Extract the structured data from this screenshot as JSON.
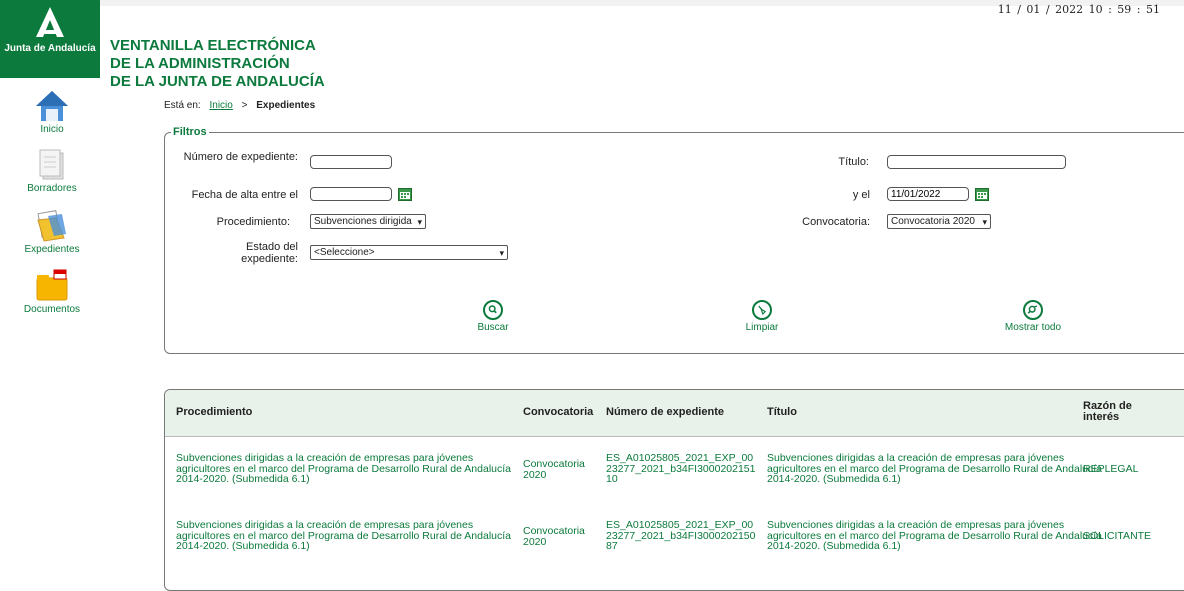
{
  "header": {
    "datetime": "11 / 01 / 2022   10 : 59 : 51",
    "logo_text": "Junta de Andalucía",
    "title_lines": [
      "VENTANILLA ELECTRÓNICA",
      "DE LA ADMINISTRACIÓN",
      "DE LA JUNTA DE ANDALUCÍA"
    ]
  },
  "breadcrumb": {
    "prefix": "Está en:",
    "home": "Inicio",
    "separator": ">",
    "current": "Expedientes"
  },
  "sidebar": {
    "items": [
      {
        "label": "Inicio",
        "icon": "home-icon"
      },
      {
        "label": "Borradores",
        "icon": "drafts-icon"
      },
      {
        "label": "Expedientes",
        "icon": "folder-icon"
      },
      {
        "label": "Documentos",
        "icon": "pdf-folder-icon"
      }
    ]
  },
  "filters": {
    "legend": "Filtros",
    "numero_label": "Número de expediente:",
    "numero_value": "",
    "titulo_label": "Título:",
    "titulo_value": "",
    "fecha_label": "Fecha de alta entre el",
    "fecha_desde": "",
    "ye_label": "y el",
    "fecha_hasta": "11/01/2022",
    "procedimiento_label": "Procedimiento:",
    "procedimiento_value": "Subvenciones dirigida",
    "convocatoria_label": "Convocatoria:",
    "convocatoria_value": "Convocatoria 2020",
    "estado_label": "Estado del expediente:",
    "estado_value": "<Seleccione>",
    "buttons": {
      "buscar": "Buscar",
      "limpiar": "Limpiar",
      "mostrar": "Mostrar todo"
    }
  },
  "table": {
    "headers": [
      "Procedimiento",
      "Convocatoria",
      "Número de expediente",
      "Título",
      "Razón de interés"
    ],
    "rows": [
      {
        "procedimiento": "Subvenciones dirigidas a la creación de empresas para jóvenes agricultores en el marco del Programa de Desarrollo Rural de Andalucía 2014-2020. (Submedida 6.1)",
        "convocatoria": "Convocatoria 2020",
        "numero": "ES_A01025805_2021_EXP_0023277_2021_b34FI300020215110",
        "titulo": "Subvenciones dirigidas a la creación de empresas para jóvenes agricultores en el marco del Programa de Desarrollo Rural de Andalucía 2014-2020. (Submedida 6.1)",
        "razon": "REPLEGAL"
      },
      {
        "procedimiento": "Subvenciones dirigidas a la creación de empresas para jóvenes agricultores en el marco del Programa de Desarrollo Rural de Andalucía 2014-2020. (Submedida 6.1)",
        "convocatoria": "Convocatoria 2020",
        "numero": "ES_A01025805_2021_EXP_0023277_2021_b34FI300020215087",
        "titulo": "Subvenciones dirigidas a la creación de empresas para jóvenes agricultores en el marco del Programa de Desarrollo Rural de Andalucía 2014-2020. (Submedida 6.1)",
        "razon": "SOLICITANTE"
      }
    ]
  },
  "colors": {
    "brand": "#0b7a3c",
    "header_bg": "#e8f1ea"
  }
}
